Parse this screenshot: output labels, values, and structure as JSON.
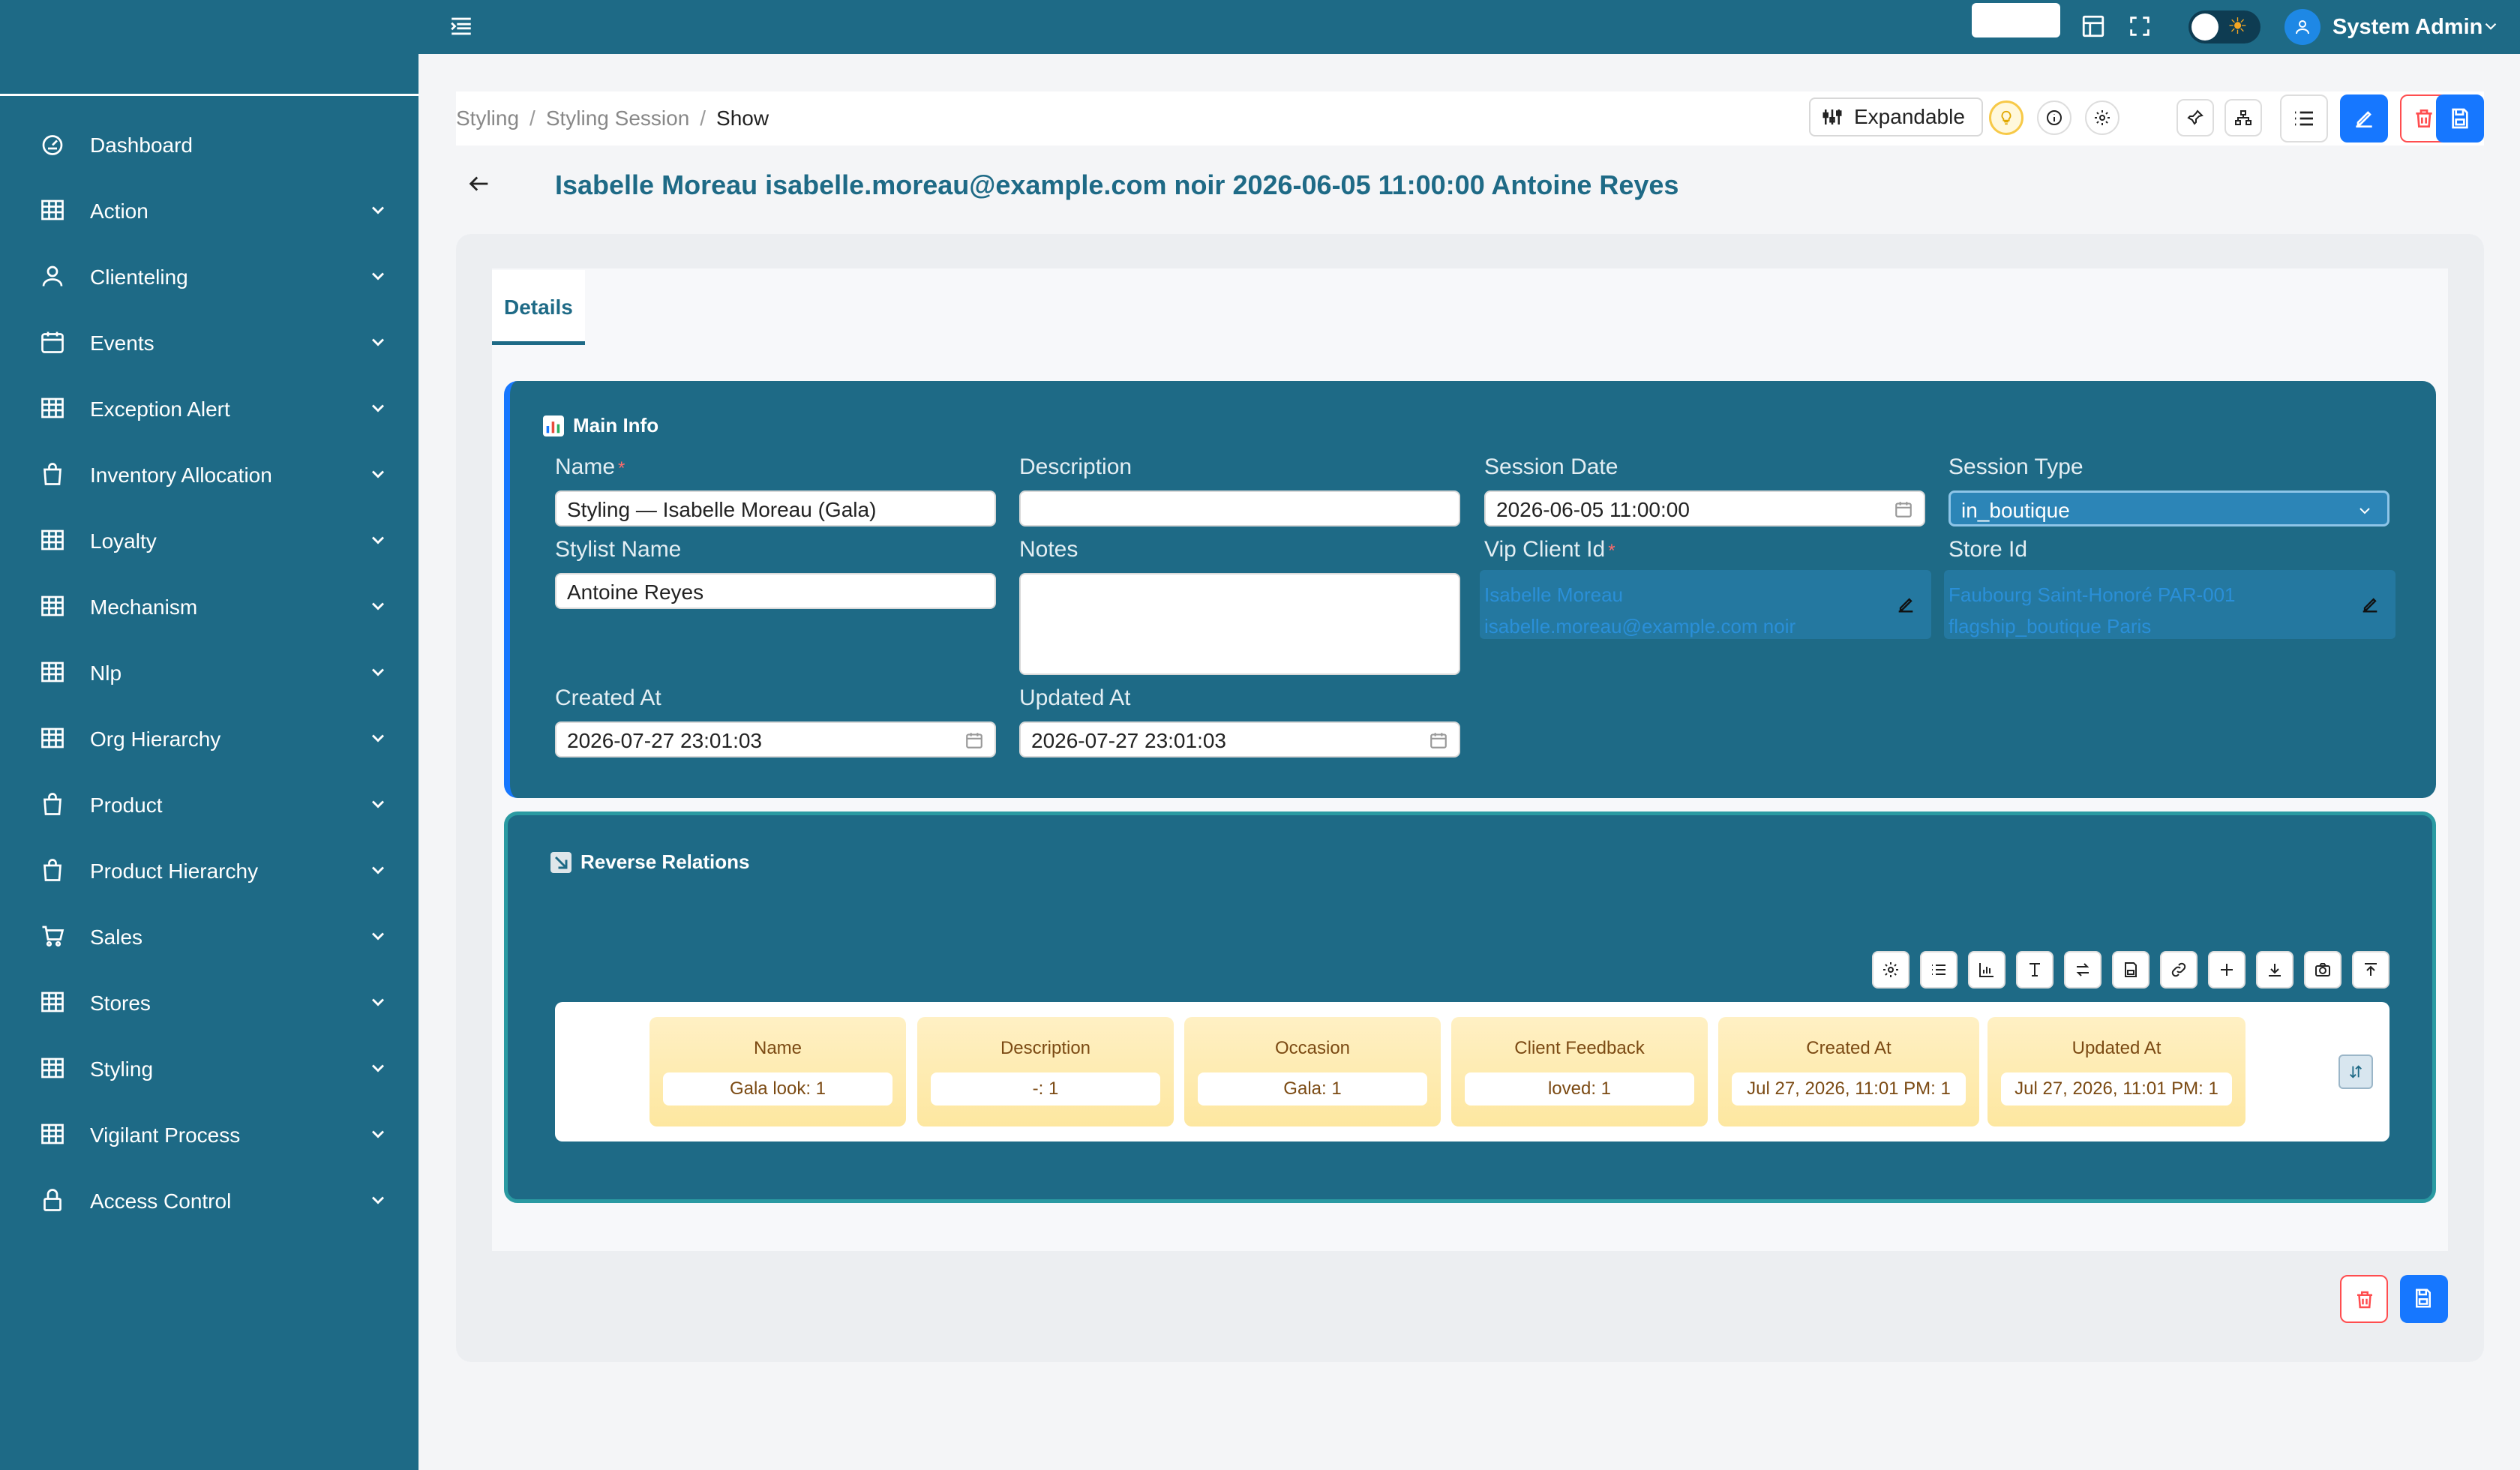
{
  "sidebar": {
    "items": [
      {
        "label": "Dashboard",
        "icon": "dashboard-icon",
        "expandable": false
      },
      {
        "label": "Action",
        "icon": "table-icon",
        "expandable": true
      },
      {
        "label": "Clienteling",
        "icon": "user-icon",
        "expandable": true
      },
      {
        "label": "Events",
        "icon": "calendar-icon",
        "expandable": true
      },
      {
        "label": "Exception Alert",
        "icon": "table-icon",
        "expandable": true
      },
      {
        "label": "Inventory Allocation",
        "icon": "bag-icon",
        "expandable": true
      },
      {
        "label": "Loyalty",
        "icon": "table-icon",
        "expandable": true
      },
      {
        "label": "Mechanism",
        "icon": "table-icon",
        "expandable": true
      },
      {
        "label": "Nlp",
        "icon": "table-icon",
        "expandable": true
      },
      {
        "label": "Org Hierarchy",
        "icon": "table-icon",
        "expandable": true
      },
      {
        "label": "Product",
        "icon": "bag-icon",
        "expandable": true
      },
      {
        "label": "Product Hierarchy",
        "icon": "bag-icon",
        "expandable": true
      },
      {
        "label": "Sales",
        "icon": "cart-icon",
        "expandable": true
      },
      {
        "label": "Stores",
        "icon": "table-icon",
        "expandable": true
      },
      {
        "label": "Styling",
        "icon": "table-icon",
        "expandable": true
      },
      {
        "label": "Vigilant Process",
        "icon": "table-icon",
        "expandable": true
      },
      {
        "label": "Access Control",
        "icon": "lock-icon",
        "expandable": true
      }
    ]
  },
  "topbar": {
    "user_name": "System Admin",
    "theme_toggle": "light"
  },
  "breadcrumb": {
    "items": [
      "Styling",
      "Styling Session",
      "Show"
    ],
    "separator": "/"
  },
  "toolbar": {
    "expandable_label": "Expandable"
  },
  "page": {
    "title": "Isabelle Moreau isabelle.moreau@example.com noir 2026-06-05 11:00:00 Antoine Reyes"
  },
  "tabs": [
    {
      "label": "Details",
      "active": true
    }
  ],
  "main_info": {
    "title": "Main Info",
    "fields": {
      "name": {
        "label": "Name",
        "value": "Styling — Isabelle Moreau (Gala)",
        "required": "*"
      },
      "description": {
        "label": "Description",
        "value": ""
      },
      "session_date": {
        "label": "Session Date",
        "value": "2026-06-05 11:00:00"
      },
      "session_type": {
        "label": "Session Type",
        "value": "in_boutique"
      },
      "stylist_name": {
        "label": "Stylist Name",
        "value": "Antoine Reyes"
      },
      "notes": {
        "label": "Notes",
        "value": ""
      },
      "vip_client_id": {
        "label": "Vip Client Id",
        "required": "*",
        "line1": "Isabelle Moreau",
        "line2": "isabelle.moreau@example.com noir"
      },
      "store_id": {
        "label": "Store Id",
        "line1": "Faubourg Saint-Honoré PAR-001",
        "line2": "flagship_boutique Paris"
      },
      "created_at": {
        "label": "Created At",
        "value": "2026-07-27 23:01:03"
      },
      "updated_at": {
        "label": "Updated At",
        "value": "2026-07-27 23:01:03"
      }
    }
  },
  "reverse_relations": {
    "title": "Reverse Relations",
    "tools": [
      "gear-icon",
      "list-icon",
      "bar-chart-icon",
      "text-height-icon",
      "swap-icon",
      "save-icon",
      "link-icon",
      "plus-icon",
      "download-icon",
      "camera-icon",
      "upload-icon"
    ],
    "columns": [
      {
        "header": "Name",
        "value": "Gala look: 1"
      },
      {
        "header": "Description",
        "value": "-: 1"
      },
      {
        "header": "Occasion",
        "value": "Gala: 1"
      },
      {
        "header": "Client Feedback",
        "value": "loved: 1"
      },
      {
        "header": "Created At",
        "value": "Jul 27, 2026, 11:01 PM: 1"
      },
      {
        "header": "Updated At",
        "value": "Jul 27, 2026, 11:01 PM: 1"
      }
    ]
  },
  "colors": {
    "primary": "#1e6a86",
    "accent_blue": "#1677ff",
    "danger": "#ff4d4f",
    "column_bg": "#fde7a0",
    "column_text": "#7b4a13"
  }
}
